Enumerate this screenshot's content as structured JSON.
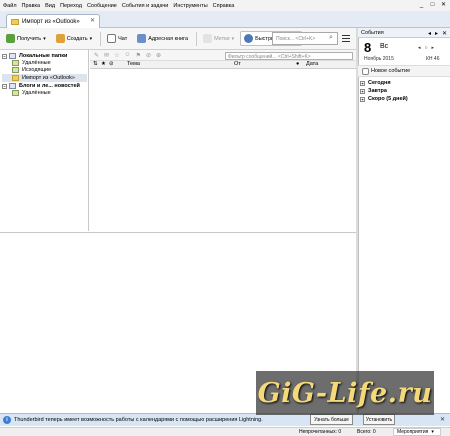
{
  "menubar": {
    "items": [
      "Файл",
      "Правка",
      "Вид",
      "Переход",
      "Сообщение",
      "События и задачи",
      "Инструменты",
      "Справка"
    ]
  },
  "window_controls": [
    "_",
    "□",
    "✕"
  ],
  "tabs": [
    {
      "label": "Импорт из «Outlook»",
      "close": "✕"
    }
  ],
  "toolbar": {
    "get": "Получить",
    "create": "Создать",
    "chat": "Чат",
    "address_book": "Адресная книга",
    "tag": "Метки",
    "quick_filter": "Быстрый фильтр",
    "search_placeholder": "Поиск... <Ctrl+K>"
  },
  "folder_pane": {
    "local_folders": "Локальные папки",
    "local_children": [
      "Удалённые",
      "Исходящие",
      "Импорт из «Outlook»"
    ],
    "blogs": "Блоги и ле... новостей",
    "blogs_children": [
      "Удалённые"
    ]
  },
  "quick_filter_bar": {
    "filter_placeholder": "Фильтр сообщений... <Ctrl+Shift+K>"
  },
  "columns": {
    "subject": "Тема",
    "from": "От",
    "date": "Дата"
  },
  "today_pane": {
    "title": "События",
    "day": "8",
    "weekday": "Вс",
    "month_year": "Ноябрь 2015",
    "week": "КН 46",
    "new_event": "Новое событие",
    "groups": [
      "Сегодня",
      "Завтра",
      "Скоро (5 дней)"
    ]
  },
  "notification": {
    "text": "Thunderbird теперь имеет возможность работы с календарями с помощью расширения Lightning.",
    "learn_more": "Узнать больше",
    "install": "Установить",
    "close": "✕"
  },
  "statusbar": {
    "unread": "Непрочитанных: 0",
    "total": "Всего: 0",
    "events": "Мероприятия"
  },
  "watermark": {
    "text": "GiG-Life.ru"
  },
  "colors": {
    "accent": "#3a7fd5",
    "selection": "#dde4ee",
    "notification_bg": "#d8e5f4"
  }
}
